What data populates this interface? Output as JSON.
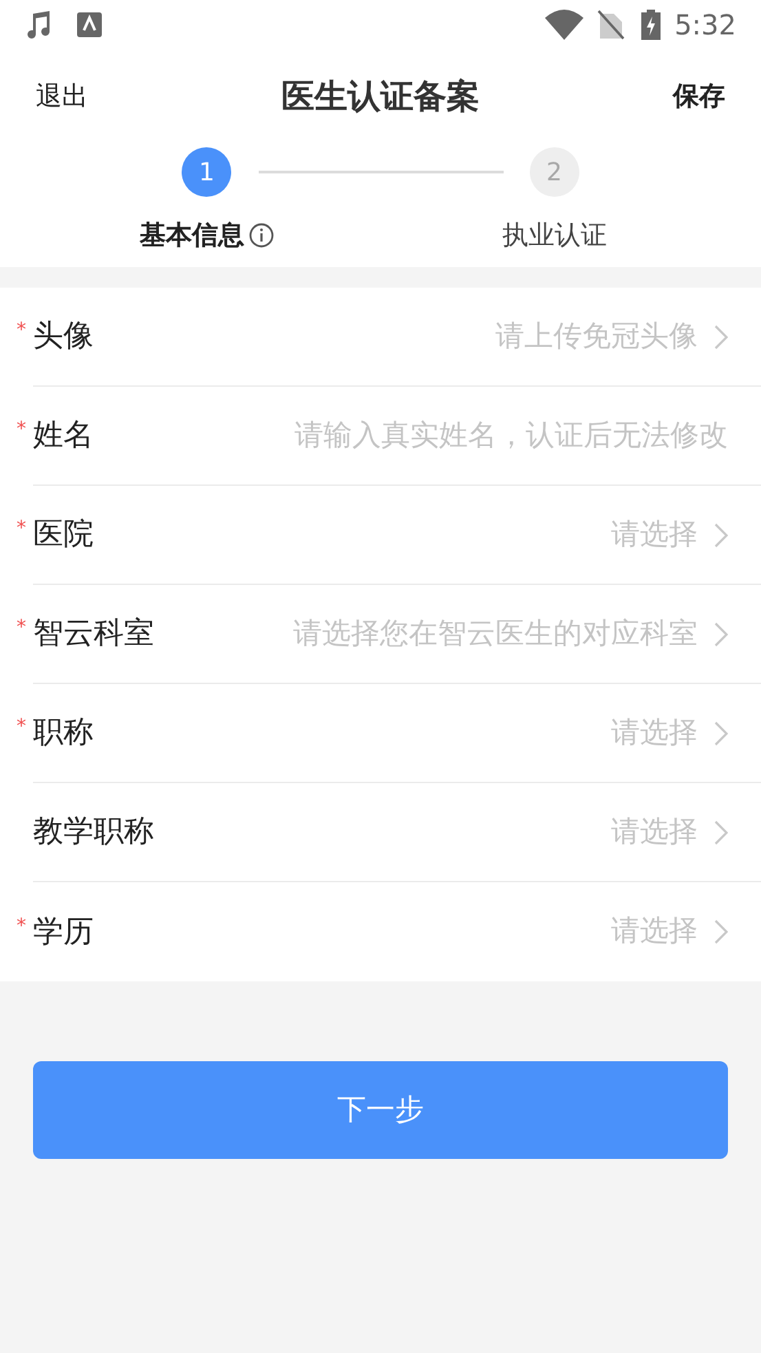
{
  "status_bar": {
    "time": "5:32"
  },
  "header": {
    "back": "退出",
    "title": "医生认证备案",
    "save": "保存"
  },
  "steps": [
    {
      "number": "1",
      "label": "基本信息",
      "selected": true,
      "info": true
    },
    {
      "number": "2",
      "label": "执业认证",
      "selected": false,
      "info": false
    }
  ],
  "form_rows": [
    {
      "marker": "*",
      "label": "头像",
      "kind": "select",
      "placeholder": "请上传免冠头像"
    },
    {
      "marker": "*",
      "label": "姓名",
      "kind": "input",
      "placeholder": "请输入真实姓名，认证后无法修改"
    },
    {
      "marker": "*",
      "label": "医院",
      "kind": "select",
      "placeholder": "请选择"
    },
    {
      "marker": "*",
      "label": "智云科室",
      "kind": "select",
      "placeholder": "请选择您在智云医生的对应科室"
    },
    {
      "marker": "*",
      "label": "职称",
      "kind": "select",
      "placeholder": "请选择"
    },
    {
      "label": "教学职称",
      "kind": "select",
      "placeholder": "请选择"
    },
    {
      "marker": "*",
      "label": "学历",
      "kind": "select",
      "placeholder": "请选择"
    }
  ],
  "next_button": "下一步"
}
